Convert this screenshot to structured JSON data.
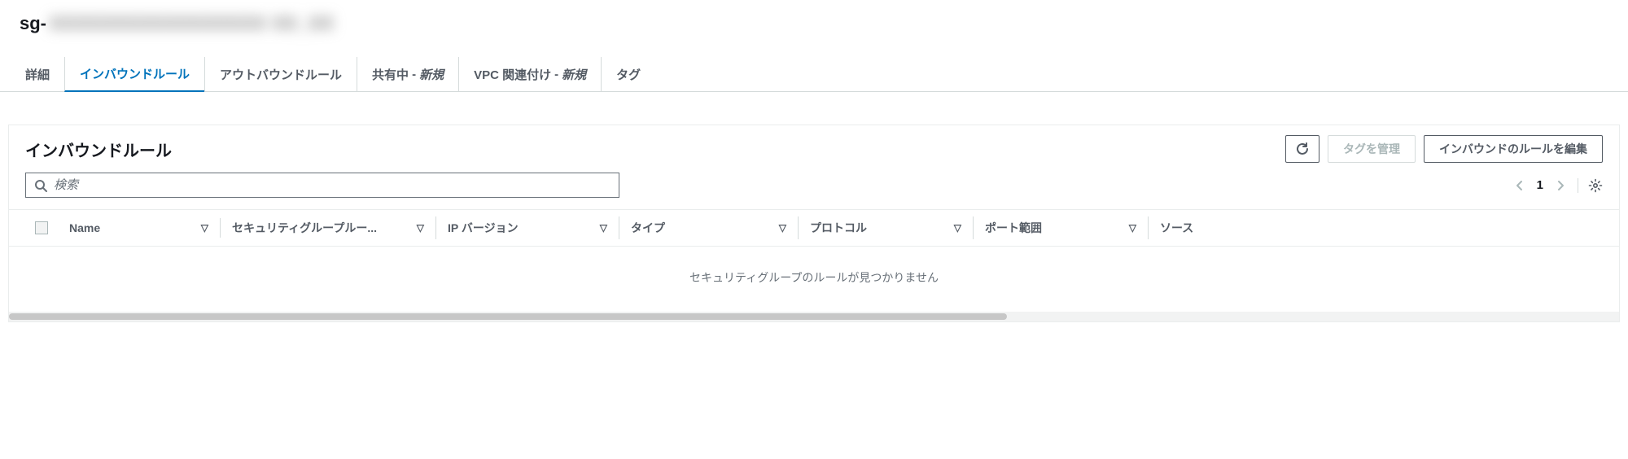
{
  "header": {
    "title_prefix": "sg-",
    "title_blurred": "XXXXXXXXXXXXXXXXX  XX_XX"
  },
  "tabs": {
    "items": [
      {
        "label": "詳細",
        "active": false,
        "badge": ""
      },
      {
        "label": "インバウンドルール",
        "active": true,
        "badge": ""
      },
      {
        "label": "アウトバウンドルール",
        "active": false,
        "badge": ""
      },
      {
        "label": "共有中",
        "active": false,
        "badge": "新規"
      },
      {
        "label": "VPC 関連付け",
        "active": false,
        "badge": "新規"
      },
      {
        "label": "タグ",
        "active": false,
        "badge": ""
      }
    ]
  },
  "panel": {
    "title": "インバウンドルール",
    "actions": {
      "refresh_label": "更新",
      "manage_tags_label": "タグを管理",
      "edit_rules_label": "インバウンドのルールを編集"
    },
    "search": {
      "placeholder": "検索",
      "value": ""
    },
    "pager": {
      "prev_label": "前へ",
      "next_label": "次へ",
      "current": "1",
      "settings_label": "設定"
    },
    "columns": {
      "name": "Name",
      "sg_rule": "セキュリティグループルー...",
      "ip_version": "IP バージョン",
      "type": "タイプ",
      "protocol": "プロトコル",
      "port_range": "ポート範囲",
      "source": "ソース"
    },
    "rows": [],
    "empty_text": "セキュリティグループのルールが見つかりません"
  },
  "icons": {
    "search": "search-icon",
    "refresh": "refresh-icon",
    "gear": "gear-icon",
    "chevron_left": "chevron-left-icon",
    "chevron_right": "chevron-right-icon",
    "sort": "sort-icon"
  }
}
